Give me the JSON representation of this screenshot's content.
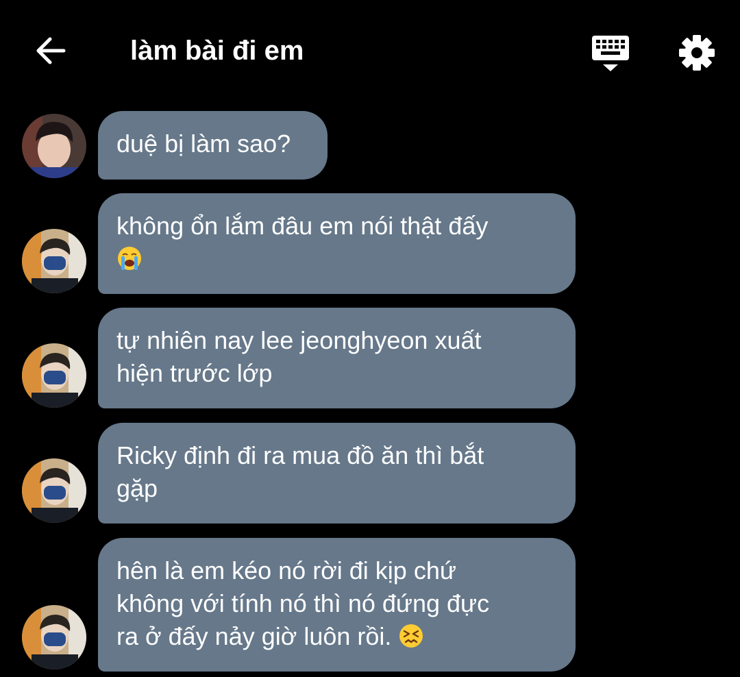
{
  "header": {
    "title": "làm bài đi em",
    "back_icon": "arrow-left-icon",
    "keyboard_icon": "keyboard-icon",
    "settings_icon": "gear-icon"
  },
  "colors": {
    "background": "#000000",
    "bubble": "#66788a",
    "text": "#ffffff"
  },
  "messages": [
    {
      "sender": "avatar-1",
      "lines": [
        "duệ bị làm sao?"
      ]
    },
    {
      "sender": "avatar-2",
      "lines": [
        "không ổn lắm đâu em nói thật đấy",
        ""
      ],
      "emoji": "loudly-crying-face-icon"
    },
    {
      "sender": "avatar-2",
      "lines": [
        "tự nhiên nay lee jeonghyeon xuất",
        "hiện trước lớp"
      ]
    },
    {
      "sender": "avatar-2",
      "lines": [
        "Ricky định đi ra mua đồ ăn thì bắt",
        "gặp"
      ]
    },
    {
      "sender": "avatar-2",
      "lines": [
        "hên là em kéo nó rời đi kịp chứ",
        "không với tính nó thì nó đứng đực",
        "ra ở đấy nảy giờ luôn rồi."
      ],
      "emoji": "persevering-face-icon"
    }
  ]
}
